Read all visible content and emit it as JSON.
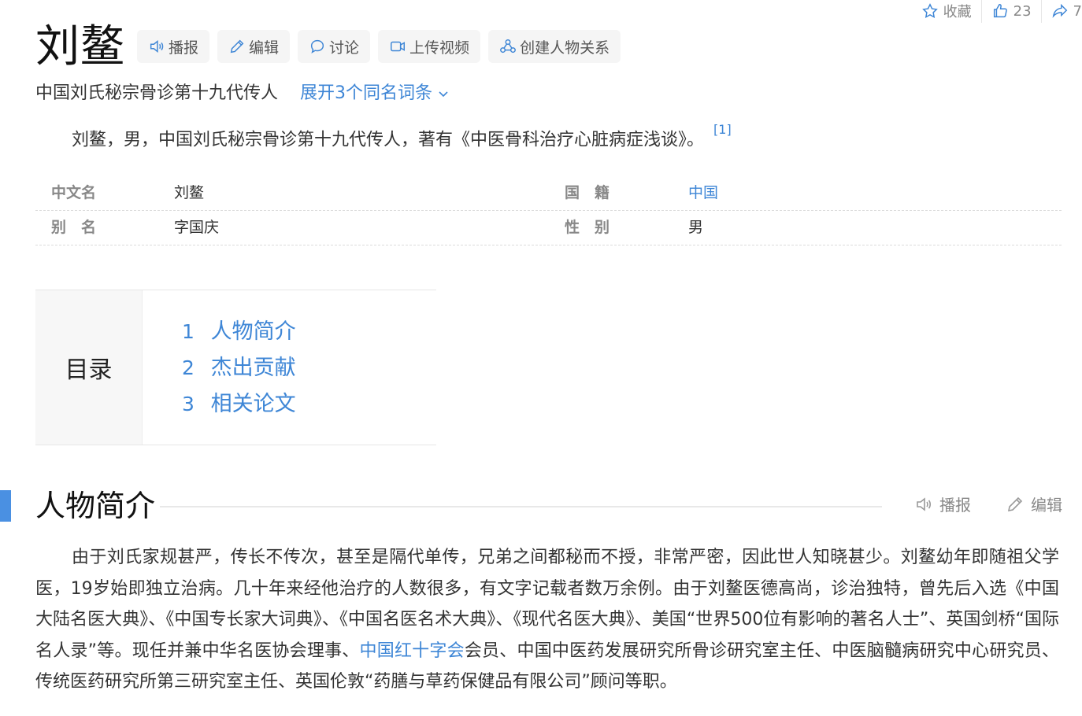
{
  "top_actions": {
    "favorite_label": "收藏",
    "like_count": "23",
    "share_count": "7"
  },
  "title": "刘鳌",
  "tools": {
    "broadcast": "播报",
    "edit": "编辑",
    "discuss": "讨论",
    "upload_video": "上传视频",
    "create_relation": "创建人物关系"
  },
  "subtitle": "中国刘氏秘宗骨诊第十九代传人",
  "expand_label": "展开3个同名词条",
  "summary": {
    "text": "刘鳌，男，中国刘氏秘宗骨诊第十九代传人，著有《中医骨科治疗心脏病症浅谈》。",
    "ref": "[1]"
  },
  "info": {
    "rows": [
      {
        "l1": "中文名",
        "v1": "刘鳌",
        "l2": "国　籍",
        "v2": "中国"
      },
      {
        "l1": "别　名",
        "v1": "字国庆",
        "l2": "性　别",
        "v2": "男"
      }
    ]
  },
  "catalog": {
    "heading": "目录",
    "items": [
      {
        "num": "1",
        "label": "人物简介"
      },
      {
        "num": "2",
        "label": "杰出贡献"
      },
      {
        "num": "3",
        "label": "相关论文"
      }
    ]
  },
  "section": {
    "title": "人物简介",
    "broadcast": "播报",
    "edit": "编辑",
    "para_before": "由于刘氏家规甚严，传长不传次，甚至是隔代单传，兄弟之间都秘而不授，非常严密，因此世人知晓甚少。刘鳌幼年即随祖父学医，19岁始即独立治病。几十年来经他治疗的人数很多，有文字记载者数万余例。由于刘鳌医德高尚，诊治独特，曾先后入选《中国大陆名医大典》、《中国专长家大词典》、《中国名医名术大典》、《现代名医大典》、美国“世界500位有影响的著名人士”、英国剑桥“国际名人录”等。现任并兼中华名医协会理事、",
    "link": "中国红十字会",
    "para_after": "会员、中国中医药发展研究所骨诊研究室主任、中医脑髓病研究中心研究员、传统医药研究所第三研究室主任、英国伦敦“药膳与草药保健品有限公司”顾问等职。"
  },
  "colors": {
    "link": "#3e86d6",
    "accent_bar": "#4a90e2"
  }
}
